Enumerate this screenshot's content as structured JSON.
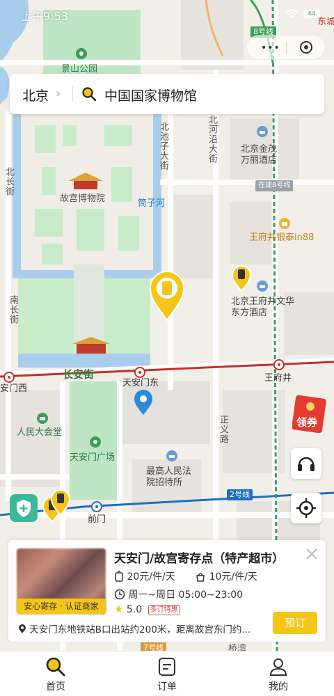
{
  "status_bar": {
    "time": "上午9:53",
    "battery": "64"
  },
  "search": {
    "city": "北京",
    "query": "中国国家博物馆"
  },
  "map": {
    "labels": {
      "jingshan": "景山公园",
      "gugong": "故宫博物院",
      "tongzihe": "筒子河",
      "beichizi": "北池子大街",
      "beiheyan": "北河沿大街",
      "jinmao": "北京金茂万丽酒店",
      "zaijian8": "在建8号线",
      "line8": "8号线",
      "dongcheng": "东城",
      "yintai": "王府井银泰in88",
      "wangfujing_hotel": "北京王府井文华东方酒店",
      "nanchang": "南长街",
      "beichang": "北长街",
      "changan": "长安街",
      "tiananmen_east": "天安门东",
      "tiananmen_west": "安门西",
      "wangfujing": "王府井",
      "renmin": "人民大会堂",
      "square": "天安门广场",
      "zhengyi": "正义路",
      "court": "最高人民法院招待所",
      "qianmen": "前门",
      "line2": "2号线",
      "line7": "7号线",
      "qiaowan": "桥湾"
    }
  },
  "coupon": {
    "label": "领券"
  },
  "card": {
    "title": "天安门/故宫寄存点（特产超市）",
    "badge": "安心寄存 · 认证商家",
    "price_large": "20元/件/天",
    "price_small": "10元/件/天",
    "hours": "周一~周日 05:00~23:00",
    "rating": "5.0",
    "rating_tag": "多订特惠",
    "address": "天安门东地铁站B口出站约200米，距离故宫东门约...",
    "book_label": "预订"
  },
  "tabbar": {
    "items": [
      {
        "label": "首页"
      },
      {
        "label": "订单"
      },
      {
        "label": "我的"
      }
    ]
  },
  "colors": {
    "accent": "#f5c518",
    "subway_blue": "#1d6fc4",
    "subway_red": "#c4302b",
    "water": "#a9cdec",
    "park": "#bfe6c4"
  }
}
